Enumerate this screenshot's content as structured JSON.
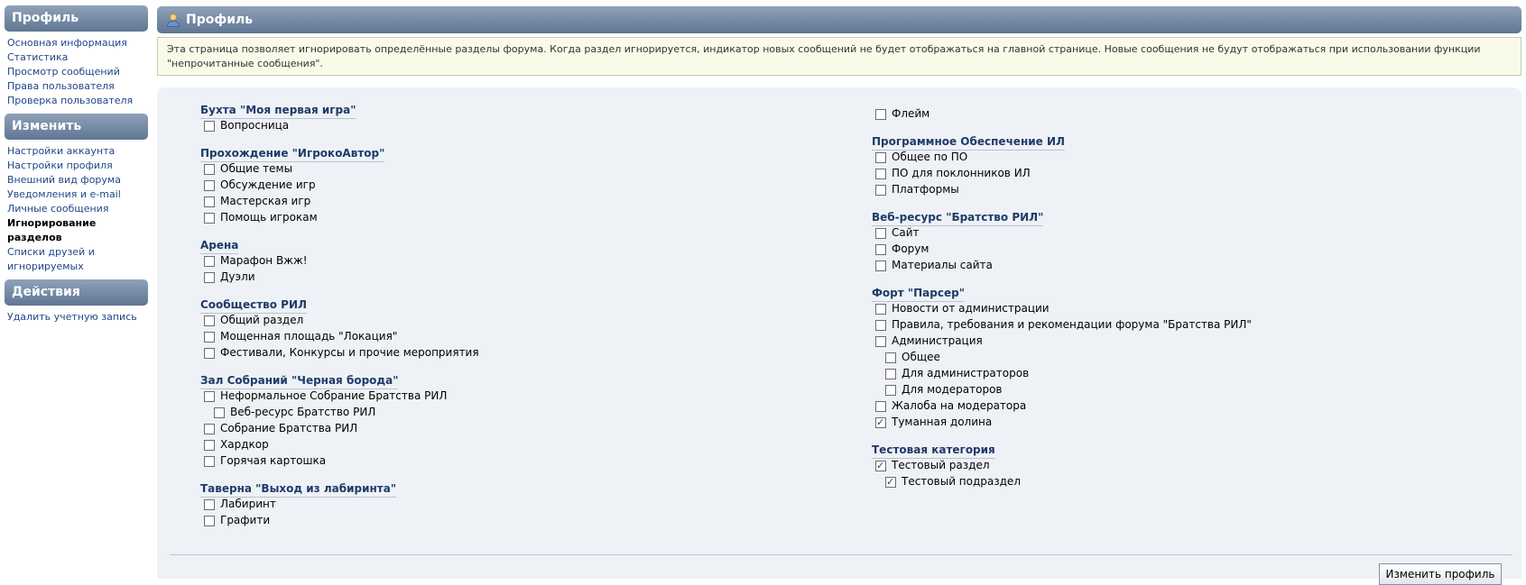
{
  "sidebar": {
    "profile": {
      "title": "Профиль",
      "items": [
        "Основная информация",
        "Статистика",
        "Просмотр сообщений",
        "Права пользователя",
        "Проверка пользователя"
      ]
    },
    "change": {
      "title": "Изменить",
      "items": [
        {
          "label": "Настройки аккаунта"
        },
        {
          "label": "Настройки профиля"
        },
        {
          "label": "Внешний вид форума"
        },
        {
          "label": "Уведомления и e-mail"
        },
        {
          "label": "Личные сообщения"
        },
        {
          "label": "Игнорирование разделов",
          "active": true
        },
        {
          "label": "Списки друзей и игнорируемых"
        }
      ]
    },
    "actions": {
      "title": "Действия",
      "items": [
        "Удалить учетную запись"
      ]
    }
  },
  "header": {
    "title": "Профиль",
    "icon": "user-profile-icon"
  },
  "notice": "Эта страница позволяет игнорировать определённые разделы форума. Когда раздел игнорируется, индикатор новых сообщений не будет отображаться на главной странице. Новые сообщения не будут отображаться при использовании функции \"непрочитанные сообщения\".",
  "left_column": [
    {
      "name": "Бухта \"Моя первая игра\"",
      "boards": [
        {
          "label": "Вопросница",
          "checked": false,
          "level": 0
        }
      ]
    },
    {
      "name": "Прохождение \"ИгрокоАвтор\"",
      "boards": [
        {
          "label": "Общие темы",
          "checked": false,
          "level": 0
        },
        {
          "label": "Обсуждение игр",
          "checked": false,
          "level": 0
        },
        {
          "label": "Мастерская игр",
          "checked": false,
          "level": 0
        },
        {
          "label": "Помощь игрокам",
          "checked": false,
          "level": 0
        }
      ]
    },
    {
      "name": "Арена",
      "boards": [
        {
          "label": "Марафон Вжж!",
          "checked": false,
          "level": 0
        },
        {
          "label": "Дуэли",
          "checked": false,
          "level": 0
        }
      ]
    },
    {
      "name": "Сообщество РИЛ",
      "boards": [
        {
          "label": "Общий раздел",
          "checked": false,
          "level": 0
        },
        {
          "label": "Мощенная площадь \"Локация\"",
          "checked": false,
          "level": 0
        },
        {
          "label": "Фестивали, Конкурсы и прочие мероприятия",
          "checked": false,
          "level": 0
        }
      ]
    },
    {
      "name": "Зал Собраний \"Черная борода\"",
      "boards": [
        {
          "label": "Неформальное Собрание Братства РИЛ",
          "checked": false,
          "level": 0
        },
        {
          "label": "Веб-ресурс Братство РИЛ",
          "checked": false,
          "level": 1
        },
        {
          "label": "Собрание Братства РИЛ",
          "checked": false,
          "level": 0
        },
        {
          "label": "Хардкор",
          "checked": false,
          "level": 0
        },
        {
          "label": "Горячая картошка",
          "checked": false,
          "level": 0
        }
      ]
    },
    {
      "name": "Таверна \"Выход из лабиринта\"",
      "boards": [
        {
          "label": "Лабиринт",
          "checked": false,
          "level": 0
        },
        {
          "label": "Графити",
          "checked": false,
          "level": 0
        }
      ]
    }
  ],
  "right_column": [
    {
      "name": "",
      "boards": [
        {
          "label": "Флейм",
          "checked": false,
          "level": 0
        }
      ]
    },
    {
      "name": "Программное Обеспечение ИЛ",
      "boards": [
        {
          "label": "Общее по ПО",
          "checked": false,
          "level": 0
        },
        {
          "label": "ПО для поклонников ИЛ",
          "checked": false,
          "level": 0
        },
        {
          "label": "Платформы",
          "checked": false,
          "level": 0
        }
      ]
    },
    {
      "name": "Веб-ресурс \"Братство РИЛ\"",
      "boards": [
        {
          "label": "Сайт",
          "checked": false,
          "level": 0
        },
        {
          "label": "Форум",
          "checked": false,
          "level": 0
        },
        {
          "label": "Материалы сайта",
          "checked": false,
          "level": 0
        }
      ]
    },
    {
      "name": "Форт \"Парсер\"",
      "boards": [
        {
          "label": "Новости от администрации",
          "checked": false,
          "level": 0
        },
        {
          "label": "Правила, требования и рекомендации форума \"Братства РИЛ\"",
          "checked": false,
          "level": 0
        },
        {
          "label": "Администрация",
          "checked": false,
          "level": 0
        },
        {
          "label": "Общее",
          "checked": false,
          "level": 1
        },
        {
          "label": "Для администраторов",
          "checked": false,
          "level": 1
        },
        {
          "label": "Для модераторов",
          "checked": false,
          "level": 1
        },
        {
          "label": "Жалоба на модератора",
          "checked": false,
          "level": 0
        },
        {
          "label": "Туманная долина",
          "checked": true,
          "level": 0
        }
      ]
    },
    {
      "name": "Тестовая категория",
      "boards": [
        {
          "label": "Тестовый раздел",
          "checked": true,
          "level": 0
        },
        {
          "label": "Тестовый подраздел",
          "checked": true,
          "level": 1
        }
      ]
    }
  ],
  "submit_label": "Изменить профиль"
}
